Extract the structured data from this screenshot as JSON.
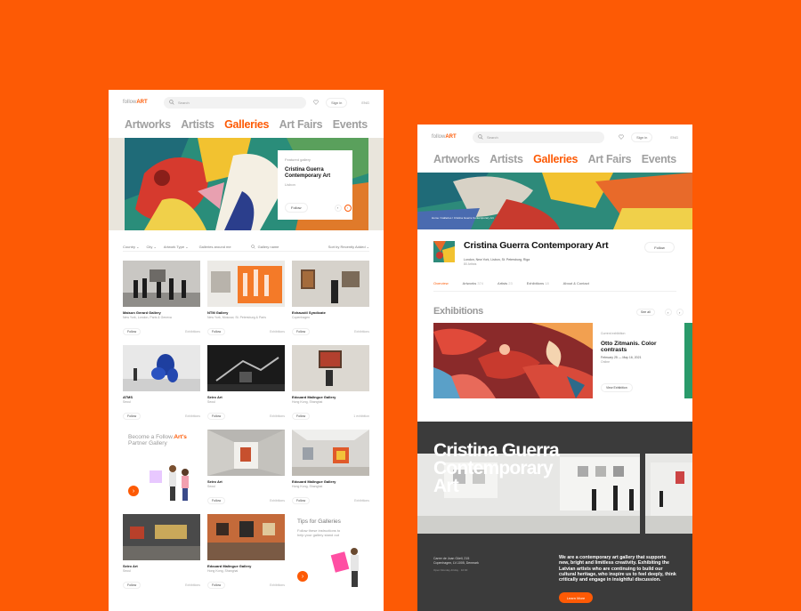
{
  "brand": {
    "logo_prefix": "follow",
    "logo_suffix": "ART",
    "accent": "#fd5a05"
  },
  "header": {
    "search_placeholder": "Search",
    "signin_label": "Sign in",
    "lang_label": "ENG"
  },
  "nav": [
    "Artworks",
    "Artists",
    "Galleries",
    "Art Fairs",
    "Events"
  ],
  "left": {
    "hero": {
      "eyebrow": "Featured gallery",
      "title_line1": "Cristina Guerra",
      "title_line2": "Contemporary Art",
      "location": "Lisbon",
      "follow_label": "Follow",
      "prev": "‹",
      "next": "›"
    },
    "filters": [
      "Country ⌄",
      "City ⌄",
      "Artwork Type ⌄",
      "Galleries around me",
      "Gallery name",
      "Sort by Recently Added ⌄"
    ],
    "galleries": [
      {
        "name": "Maison Gerard Gallery",
        "location": "New York, London, Paris & Geneva",
        "follow": "Follow",
        "exhibitions": "Exhibitions"
      },
      {
        "name": "NTM Gallery",
        "location": "New York, Moscow, St. Petersburg & Paris",
        "follow": "Follow",
        "exhibitions": "Exhibitions"
      },
      {
        "name": "Exhaustil Syndicate",
        "location": "Copenhagen",
        "follow": "Follow",
        "exhibitions": "Exhibitions"
      },
      {
        "name": "ATMS",
        "location": "Seoul",
        "follow": "Follow",
        "exhibitions": "Exhibitions"
      },
      {
        "name": "Seiro Art",
        "location": "Seoul",
        "follow": "Follow",
        "exhibitions": "Exhibitions"
      },
      {
        "name": "Edouard Malingue Gallery",
        "location": "Hong Kong, Shanghai",
        "follow": "Follow",
        "exhibitions": "1 exhibition"
      },
      {
        "name": "Seiro Art",
        "location": "Seoul",
        "follow": "Follow",
        "exhibitions": "Exhibitions"
      },
      {
        "name": "Edouard Malingue Gallery",
        "location": "Hong Kong, Shanghai",
        "follow": "Follow",
        "exhibitions": "Exhibitions"
      },
      {
        "name": "Seiro Art",
        "location": "Seoul",
        "follow": "Follow",
        "exhibitions": "Exhibitions"
      },
      {
        "name": "Edouard Malingue Gallery",
        "location": "Hong Kong, Shanghai",
        "follow": "Follow",
        "exhibitions": "Exhibitions"
      }
    ],
    "promo": {
      "line1": "Become a Follow.",
      "brand": "Art's",
      "line2": "Partner Gallery",
      "arrow": "›"
    },
    "tips": {
      "title": "Tips for Galleries",
      "text": "Follow these instructions to help your gallery stand out",
      "arrow": "›"
    }
  },
  "right": {
    "breadcrumb": "Home  /  Galleries  /  Cristina Guerra Contemporary Art",
    "gallery_name": "Cristina Guerra Contemporary Art",
    "cities": "London, New York, Lisbon, St. Petersburg, Riga",
    "artists_count": "80 Artists",
    "follow_label": "Follow",
    "tabs": [
      {
        "label": "Overview",
        "count": ""
      },
      {
        "label": "Artworks",
        "count": "374"
      },
      {
        "label": "Artists",
        "count": "23"
      },
      {
        "label": "Exhibitions",
        "count": "18"
      },
      {
        "label": "About & Contact",
        "count": ""
      }
    ],
    "exhibitions": {
      "heading": "Exhibitions",
      "see_all": "See all",
      "prev": "‹",
      "next": "›",
      "eyebrow": "Current exhibition",
      "title": "Otto Zitmanis. Color contrasts",
      "dates": "February 25 — May 16, 2021",
      "place": "Online",
      "button": "View Exhibition"
    },
    "banner": {
      "title_line1": "Cristina Guerra",
      "title_line2": "Contemporary",
      "title_line3": "Art",
      "address": "Carrer de Joan Güell, 215\nCopenhagen, LV-1005, Denmark",
      "hours": "Open Monday-Friday · 10:00",
      "about": "We are a contemporary art gallery that supports new, bright and limitless creativity. Exhibiting the Latvian artists who are continuing to build our cultural heritage, who inspire us to feel deeply, think critically and engage in insightful discussion.",
      "button": "Learn More"
    }
  }
}
